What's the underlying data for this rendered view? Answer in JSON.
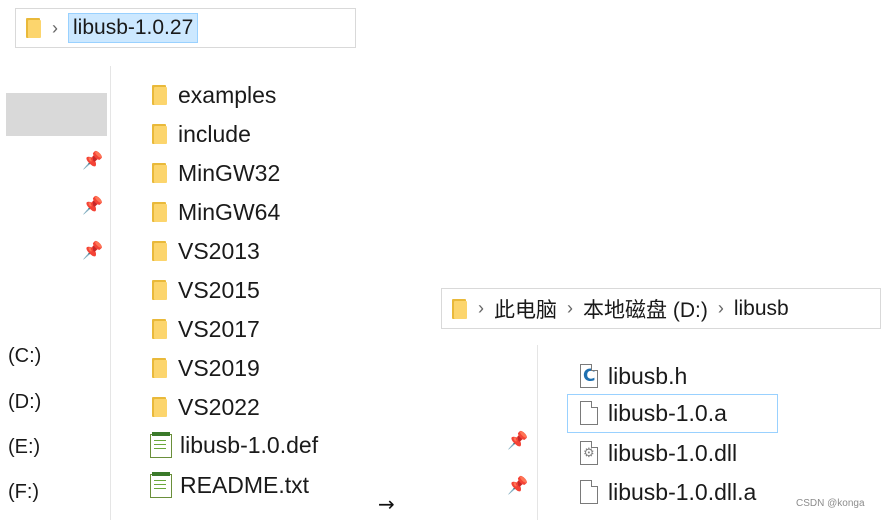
{
  "left_window": {
    "address": {
      "folder_icon": "folder-icon",
      "path": "libusb-1.0.27"
    },
    "drives": [
      "(C:)",
      "(D:)",
      "(E:)",
      "(F:)"
    ],
    "items": [
      {
        "name": "examples",
        "icon": "folder-icon"
      },
      {
        "name": "include",
        "icon": "folder-icon"
      },
      {
        "name": "MinGW32",
        "icon": "folder-icon"
      },
      {
        "name": "MinGW64",
        "icon": "folder-icon"
      },
      {
        "name": "VS2013",
        "icon": "folder-icon"
      },
      {
        "name": "VS2015",
        "icon": "folder-icon"
      },
      {
        "name": "VS2017",
        "icon": "folder-icon"
      },
      {
        "name": "VS2019",
        "icon": "folder-icon"
      },
      {
        "name": "VS2022",
        "icon": "folder-icon"
      },
      {
        "name": "libusb-1.0.def",
        "icon": "notepad-file-icon"
      },
      {
        "name": "README.txt",
        "icon": "notepad-file-icon"
      }
    ]
  },
  "arrow": "→",
  "right_window": {
    "address": {
      "folder_icon": "folder-icon",
      "segments": [
        "此电脑",
        "本地磁盘 (D:)",
        "libusb"
      ]
    },
    "items": [
      {
        "name": "libusb.h",
        "icon": "c-header-file-icon"
      },
      {
        "name": "libusb-1.0.a",
        "icon": "blank-file-icon",
        "selected": true
      },
      {
        "name": "libusb-1.0.dll",
        "icon": "dll-file-icon"
      },
      {
        "name": "libusb-1.0.dll.a",
        "icon": "blank-file-icon"
      }
    ]
  },
  "watermark": "CSDN @konga",
  "colors": {
    "selection_bg": "#cce8ff",
    "selection_border": "#99d1ff",
    "folder": "#fcd56d"
  }
}
